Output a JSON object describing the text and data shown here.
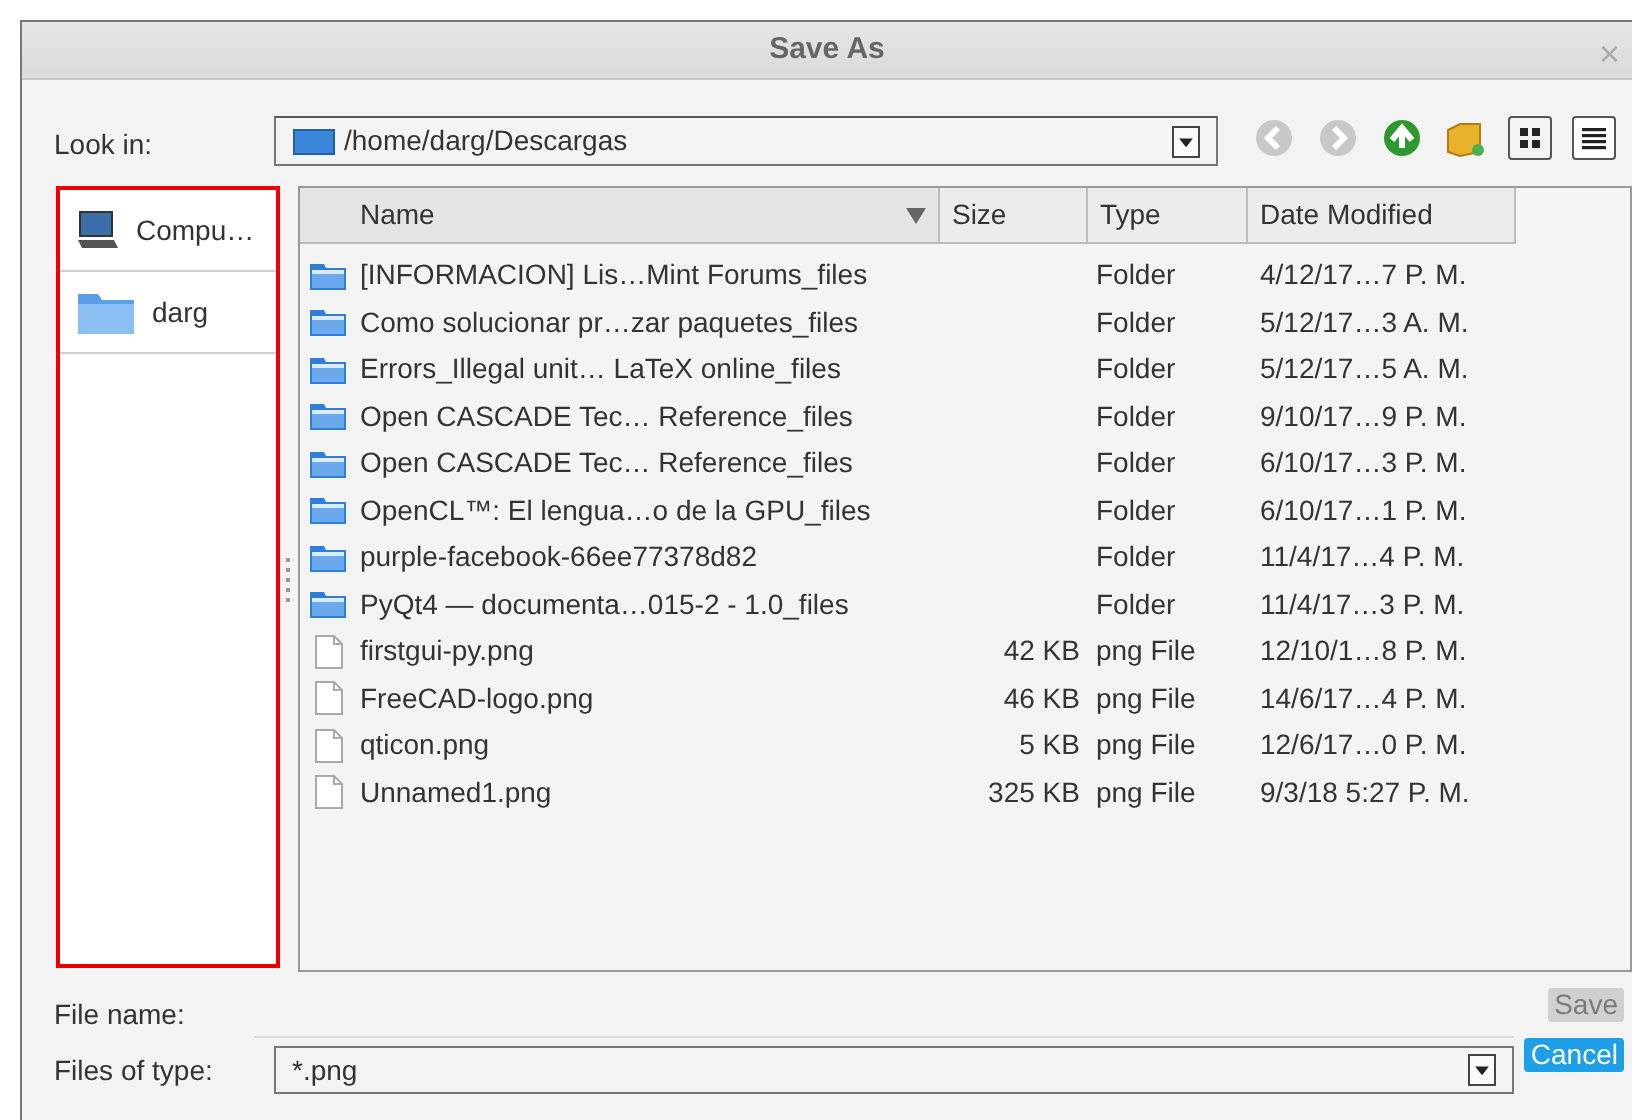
{
  "window": {
    "title": "Save As",
    "close": "×"
  },
  "look_in": {
    "label": "Look in:",
    "path": "/home/darg/Descargas"
  },
  "sidebar": {
    "items": [
      {
        "label": "Compu…",
        "kind": "computer",
        "selected": false
      },
      {
        "label": "darg",
        "kind": "folder",
        "selected": false
      }
    ]
  },
  "table": {
    "columns": [
      {
        "label": "Name",
        "sorted": true
      },
      {
        "label": "Size",
        "sorted": false
      },
      {
        "label": "Type",
        "sorted": false
      },
      {
        "label": "Date Modified",
        "sorted": false
      }
    ],
    "rows": [
      {
        "kind": "folder",
        "name": "[INFORMACION] Lis…Mint Forums_files",
        "type": "Folder",
        "date": "4/12/17…7 P. M."
      },
      {
        "kind": "folder",
        "name": "Como solucionar pr…zar paquetes_files",
        "type": "Folder",
        "date": "5/12/17…3 A. M."
      },
      {
        "kind": "folder",
        "name": "Errors_Illegal unit… LaTeX online_files",
        "type": "Folder",
        "date": "5/12/17…5 A. M."
      },
      {
        "kind": "folder",
        "name": "Open CASCADE Tec… Reference_files",
        "type": "Folder",
        "date": "9/10/17…9 P. M."
      },
      {
        "kind": "folder",
        "name": "Open CASCADE Tec… Reference_files",
        "type": "Folder",
        "date": "6/10/17…3 P. M."
      },
      {
        "kind": "folder",
        "name": "OpenCL™: El lengua…o de la GPU_files",
        "type": "Folder",
        "date": "6/10/17…1 P. M."
      },
      {
        "kind": "folder",
        "name": "purple-facebook-66ee77378d82",
        "type": "Folder",
        "date": "11/4/17…4 P. M."
      },
      {
        "kind": "folder",
        "name": "PyQt4 — documenta…015-2 - 1.0_files",
        "type": "Folder",
        "date": "11/4/17…3 P. M."
      },
      {
        "kind": "file",
        "name": "firstgui-py.png",
        "size": "42 KB",
        "type": "png File",
        "date": "12/10/1…8 P. M."
      },
      {
        "kind": "file",
        "name": "FreeCAD-logo.png",
        "size": "46 KB",
        "type": "png File",
        "date": "14/6/17…4 P. M."
      },
      {
        "kind": "file",
        "name": "qticon.png",
        "size": "5 KB",
        "type": "png File",
        "date": "12/6/17…0 P. M."
      },
      {
        "kind": "file",
        "name": "Unnamed1.png",
        "size": "325 KB",
        "type": "png File",
        "date": "9/3/18 5:27 P. M."
      }
    ]
  },
  "file_name": {
    "label": "File name:"
  },
  "file_type": {
    "label": "Files of type:",
    "value": "*.png"
  },
  "buttons": [
    {
      "label": "Save",
      "disabled": true,
      "focused": false
    },
    {
      "label": "Cancel",
      "disabled": false,
      "focused": true
    }
  ]
}
